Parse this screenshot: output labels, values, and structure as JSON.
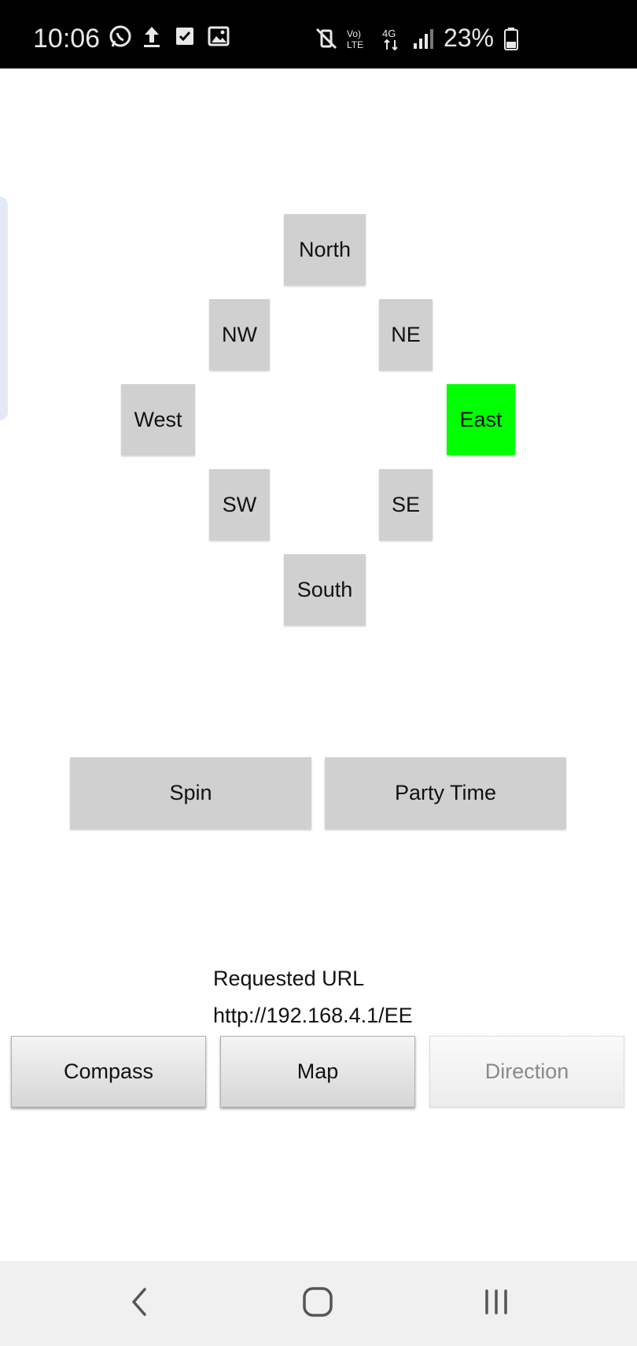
{
  "status_bar": {
    "time": "10:06",
    "battery": "23%",
    "left_icons": [
      "whatsapp-icon",
      "upload-icon",
      "checkbox-icon",
      "image-icon"
    ],
    "right_icons": [
      "mute-vibrate-icon",
      "volte-icon",
      "4g-icon",
      "signal-icon",
      "battery-icon"
    ]
  },
  "compass": {
    "north": "North",
    "nw": "NW",
    "ne": "NE",
    "west": "West",
    "east": "East",
    "sw": "SW",
    "se": "SE",
    "south": "South",
    "active": "East",
    "active_color": "#00ff00",
    "button_color": "#d0d0d0"
  },
  "actions": {
    "spin": "Spin",
    "party": "Party Time"
  },
  "url_info": {
    "label": "Requested URL",
    "value": "http://192.168.4.1/EE"
  },
  "tabs": {
    "compass": "Compass",
    "map": "Map",
    "direction": "Direction"
  },
  "nav_bar": {
    "back": "back-icon",
    "home": "home-icon",
    "recents": "recents-icon"
  }
}
